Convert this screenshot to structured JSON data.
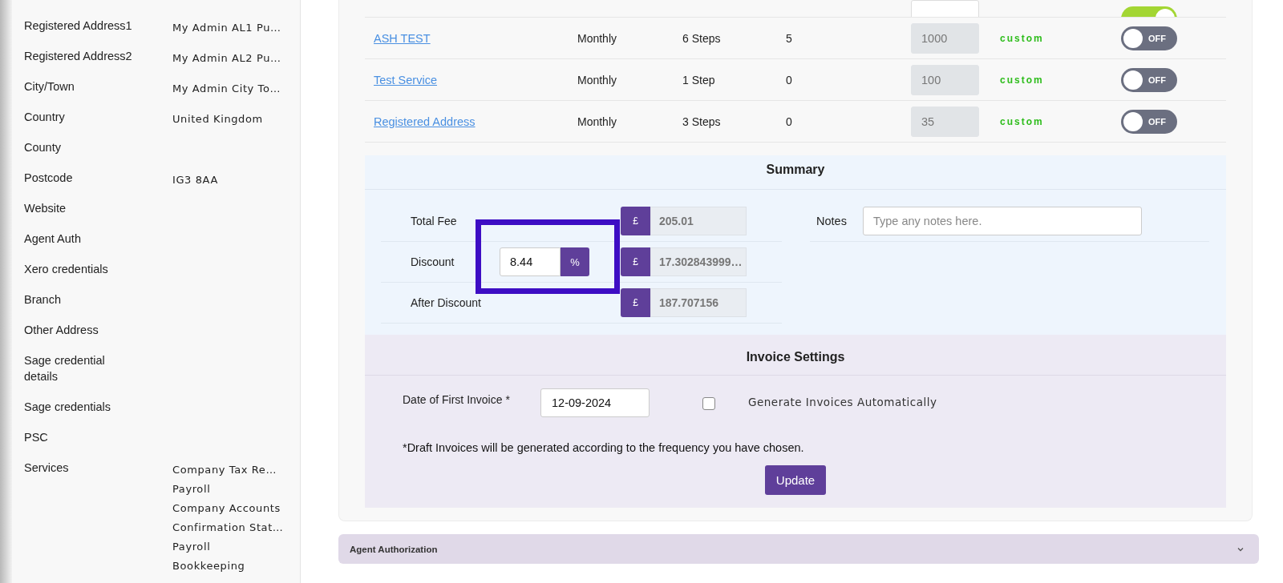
{
  "sidebar": {
    "fields": [
      {
        "label": "Registered Address1",
        "values": [
          "My Admin AL1 Pu…"
        ]
      },
      {
        "label": "Registered Address2",
        "values": [
          "My Admin AL2 Pu…"
        ]
      },
      {
        "label": "City/Town",
        "values": [
          "My Admin City To…"
        ]
      },
      {
        "label": "Country",
        "values": [
          "United Kingdom"
        ]
      },
      {
        "label": "County"
      },
      {
        "label": "Postcode",
        "values": [
          "IG3 8AA"
        ]
      },
      {
        "label": "Website"
      },
      {
        "label": "Agent Auth"
      },
      {
        "label": "Xero credentials"
      },
      {
        "label": "Branch"
      },
      {
        "label": "Other Address"
      },
      {
        "label": "Sage credential details"
      },
      {
        "label": "Sage credentials"
      },
      {
        "label": "PSC"
      },
      {
        "label": "Services",
        "values": [
          "Company Tax Re…",
          "Payroll",
          "Company Accounts",
          "Confirmation Stat…",
          "Payroll",
          "Bookkeeping"
        ]
      }
    ]
  },
  "services": {
    "rows": [
      {
        "kind": "partial",
        "disabled": false,
        "on": true
      },
      {
        "kind": "full",
        "name": "ASH TEST",
        "frequency": "Monthly",
        "steps": "6 Steps",
        "count": "5",
        "fee": "1000",
        "disabled": true,
        "type": "custom",
        "on": false,
        "toggle_label": "OFF"
      },
      {
        "kind": "full",
        "name": "Test Service",
        "frequency": "Monthly",
        "steps": "1 Step",
        "count": "0",
        "fee": "100",
        "disabled": true,
        "type": "custom",
        "on": false,
        "toggle_label": "OFF"
      },
      {
        "kind": "full",
        "name": "Registered Address",
        "frequency": "Monthly",
        "steps": "3 Steps",
        "count": "0",
        "fee": "35",
        "disabled": true,
        "type": "custom",
        "on": false,
        "toggle_label": "OFF"
      }
    ]
  },
  "summary": {
    "title": "Summary",
    "rows": [
      {
        "label": "Total Fee",
        "currency": "£",
        "amount": "205.01"
      },
      {
        "label": "Discount",
        "percent_value": "8.44",
        "percent_unit": "%",
        "currency": "£",
        "amount": "17.302843999…"
      },
      {
        "label": "After Discount",
        "currency": "£",
        "amount": "187.707156"
      }
    ],
    "notes": {
      "label": "Notes",
      "placeholder": "Type any notes here."
    }
  },
  "invoice": {
    "title": "Invoice Settings",
    "date_label": "Date of First Invoice *",
    "date_value": "12-09-2024",
    "auto": {
      "label": "Generate Invoices Automatically",
      "checked": false
    },
    "note": "*Draft Invoices will be generated according to the frequency you have chosen.",
    "button": "Update"
  },
  "accordions": [
    {
      "title": "Agent Authorization",
      "expanded": false
    }
  ]
}
